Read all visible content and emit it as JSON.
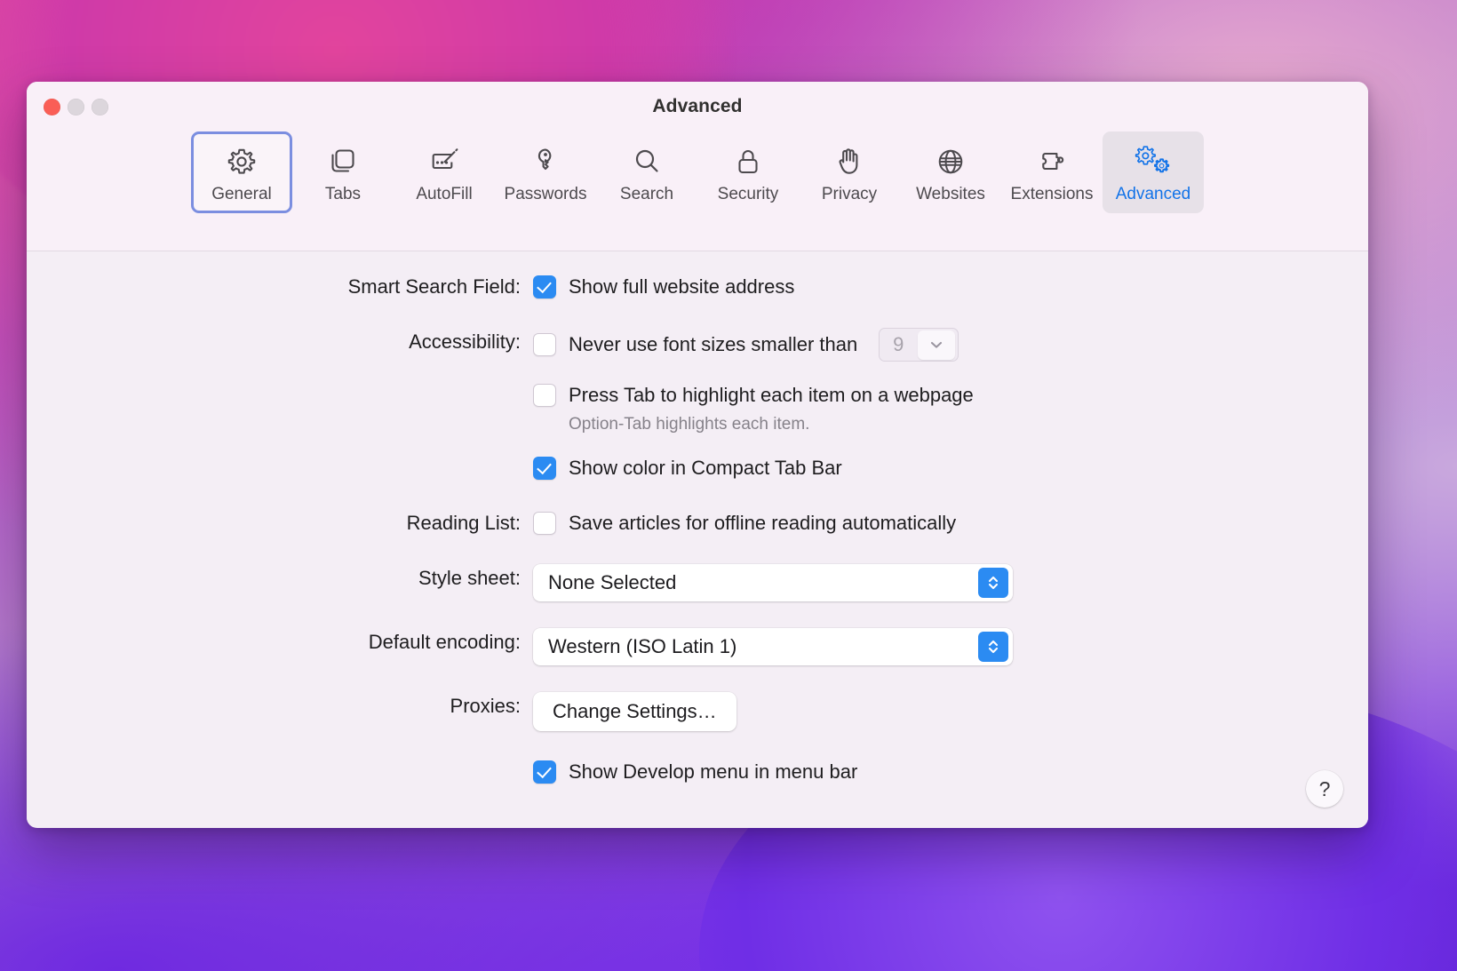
{
  "window": {
    "title": "Advanced",
    "traffic_lights": [
      "close",
      "minimize",
      "zoom"
    ],
    "accent_blue": "#2b8bf2",
    "focus_ring": "#7b8ee0",
    "background": "#f4eef5"
  },
  "toolbar": {
    "items": [
      {
        "label": "General",
        "icon": "gear-icon",
        "state": "focused"
      },
      {
        "label": "Tabs",
        "icon": "tabs-icon",
        "state": "normal"
      },
      {
        "label": "AutoFill",
        "icon": "autofill-icon",
        "state": "normal"
      },
      {
        "label": "Passwords",
        "icon": "key-icon",
        "state": "normal"
      },
      {
        "label": "Search",
        "icon": "magnifier-icon",
        "state": "normal"
      },
      {
        "label": "Security",
        "icon": "lock-icon",
        "state": "normal"
      },
      {
        "label": "Privacy",
        "icon": "hand-icon",
        "state": "normal"
      },
      {
        "label": "Websites",
        "icon": "globe-icon",
        "state": "normal"
      },
      {
        "label": "Extensions",
        "icon": "puzzle-icon",
        "state": "normal"
      },
      {
        "label": "Advanced",
        "icon": "double-gear-icon",
        "state": "selected"
      }
    ]
  },
  "main": {
    "smart_search": {
      "label": "Smart Search Field:",
      "checkbox_label": "Show full website address",
      "checked": true
    },
    "accessibility": {
      "label": "Accessibility:",
      "min_font": {
        "checkbox_label": "Never use font sizes smaller than",
        "checked": false,
        "value": "9",
        "enabled": false
      },
      "press_tab": {
        "checkbox_label": "Press Tab to highlight each item on a webpage",
        "checked": false,
        "hint": "Option-Tab highlights each item."
      },
      "compact_tab_color": {
        "checkbox_label": "Show color in Compact Tab Bar",
        "checked": true
      }
    },
    "reading_list": {
      "label": "Reading List:",
      "checkbox_label": "Save articles for offline reading automatically",
      "checked": false
    },
    "style_sheet": {
      "label": "Style sheet:",
      "value": "None Selected"
    },
    "default_encoding": {
      "label": "Default encoding:",
      "value": "Western (ISO Latin 1)"
    },
    "proxies": {
      "label": "Proxies:",
      "button_label": "Change Settings…"
    },
    "develop_menu": {
      "checkbox_label": "Show Develop menu in menu bar",
      "checked": true
    },
    "help_label": "?"
  }
}
